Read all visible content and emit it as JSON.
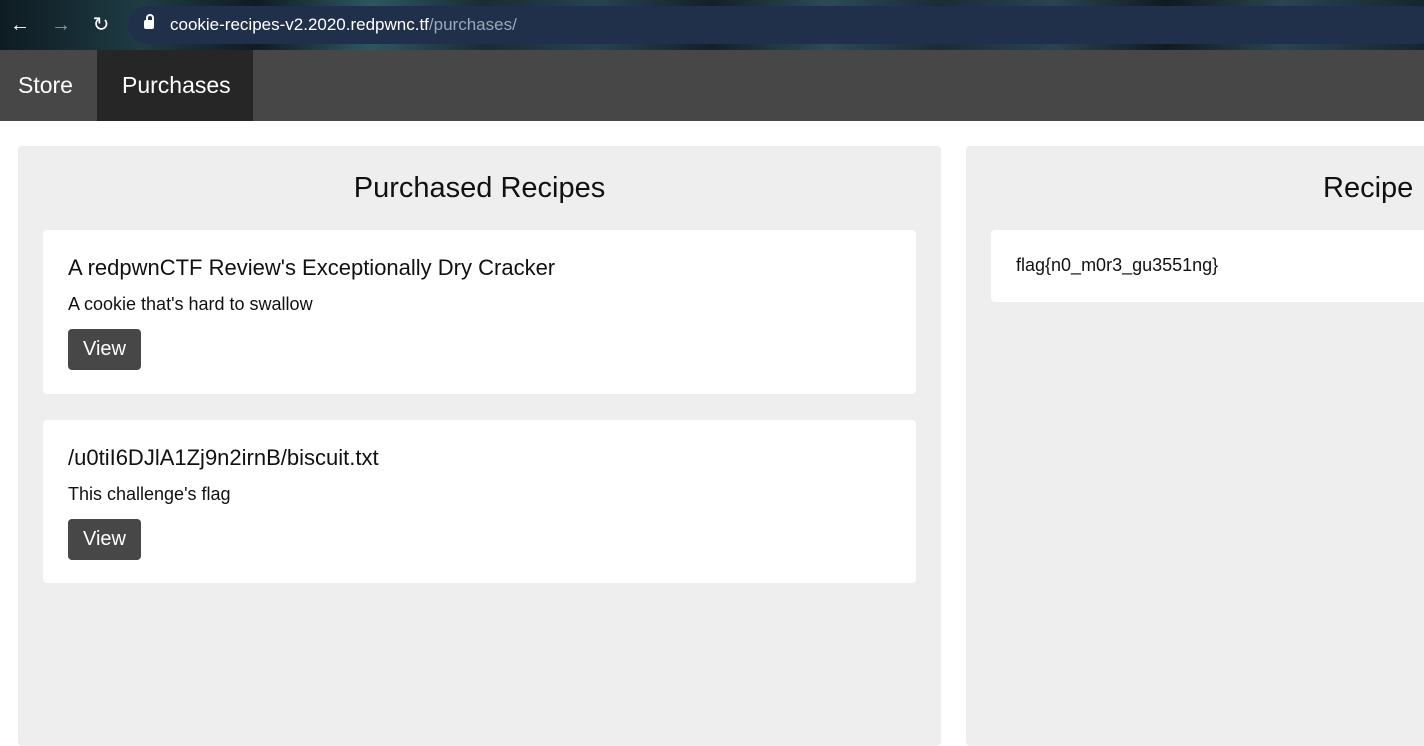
{
  "browser": {
    "url_host": "cookie-recipes-v2.2020.redpwnc.tf",
    "url_path": "/purchases/"
  },
  "nav": {
    "items": [
      {
        "label": "Store"
      },
      {
        "label": "Purchases"
      }
    ]
  },
  "purchased": {
    "title": "Purchased Recipes",
    "recipes": [
      {
        "name": "A redpwnCTF Review's Exceptionally Dry Cracker",
        "description": "A cookie that's hard to swallow",
        "button": "View"
      },
      {
        "name": "/u0tiI6DJlA1Zj9n2irnB/biscuit.txt",
        "description": "This challenge's flag",
        "button": "View"
      }
    ]
  },
  "recipe": {
    "title": "Recipe",
    "content": "flag{n0_m0r3_gu3551ng}"
  }
}
